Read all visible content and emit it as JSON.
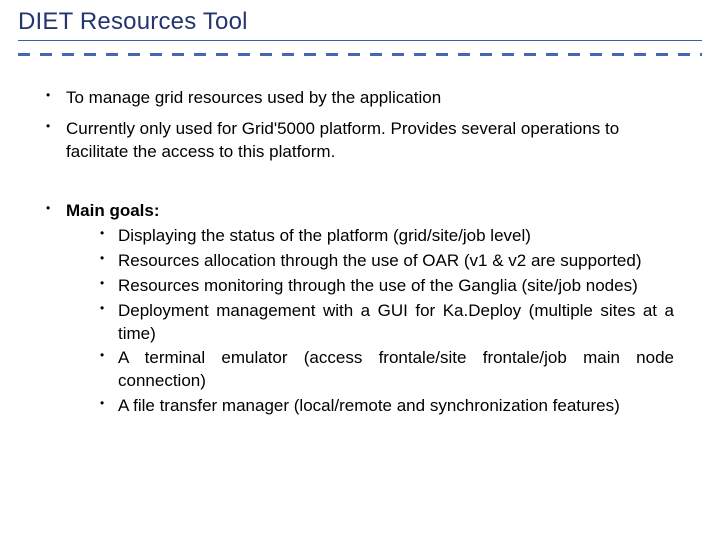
{
  "title": "DIET Resources Tool",
  "intro_bullets": [
    "To manage grid resources used by the application",
    "Currently only used for Grid'5000 platform. Provides several operations to facilitate the access to this platform."
  ],
  "main_goals_label": "Main goals:",
  "main_goals": [
    "Displaying the status of the platform (grid/site/job level)",
    "Resources allocation through the use of OAR (v1 & v2 are supported)",
    "Resources monitoring through the use of the Ganglia (site/job nodes)",
    "Deployment management with a GUI for Ka.Deploy (multiple sites at a time)",
    "A terminal emulator (access frontale/site frontale/job main node connection)",
    "A file transfer manager (local/remote and synchronization features)"
  ]
}
